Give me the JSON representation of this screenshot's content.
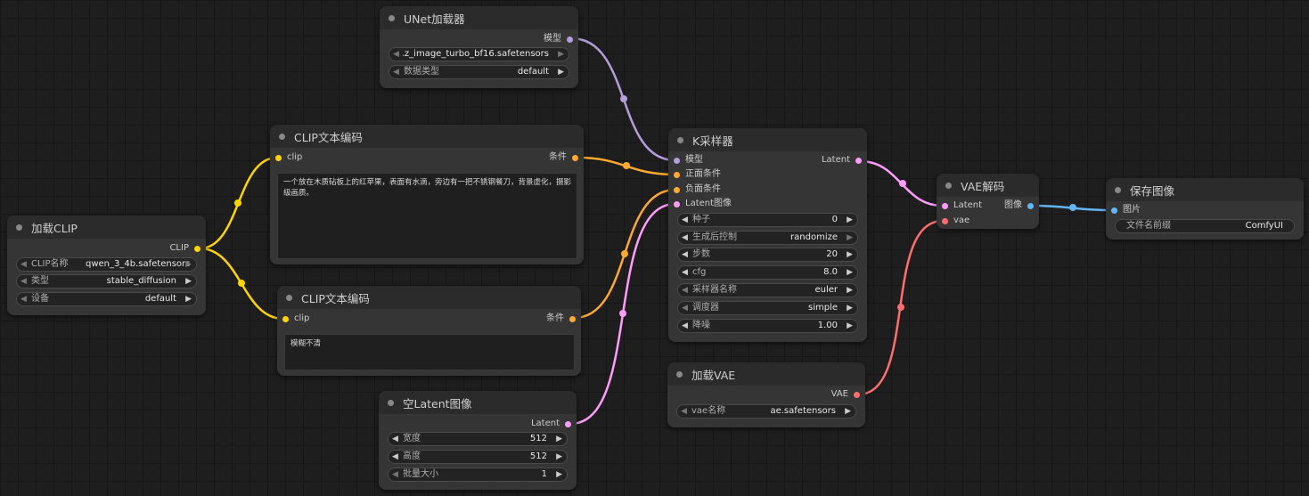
{
  "colors": {
    "clip": "#ffd500",
    "conditioning": "#ffa931",
    "model": "#b39ddb",
    "latent": "#ff9cf9",
    "vae": "#ff6e6e",
    "image": "#64b5f6"
  },
  "nodes": {
    "load_clip": {
      "title": "加载CLIP",
      "output": "CLIP",
      "widgets": [
        {
          "label": "CLIP名称",
          "value": "qwen_3_4b.safetensors"
        },
        {
          "label": "类型",
          "value": "stable_diffusion"
        },
        {
          "label": "设备",
          "value": "default"
        }
      ]
    },
    "clip_text_pos": {
      "title": "CLIP文本编码",
      "input": "clip",
      "output": "条件",
      "text": "一个放在木质砧板上的红苹果，表面有水滴，旁边有一把不锈钢餐刀，背景虚化，摄影级画质。"
    },
    "clip_text_neg": {
      "title": "CLIP文本编码",
      "input": "clip",
      "output": "条件",
      "text": "模糊不清"
    },
    "unet": {
      "title": "UNet加载器",
      "output": "模型",
      "widgets": [
        {
          "label": "",
          "value": "z_image_turbo_bf16.safetensors"
        },
        {
          "label": "数据类型",
          "value": "default"
        }
      ]
    },
    "empty_latent": {
      "title": "空Latent图像",
      "output": "Latent",
      "widgets": [
        {
          "label": "宽度",
          "value": "512"
        },
        {
          "label": "高度",
          "value": "512"
        },
        {
          "label": "批量大小",
          "value": "1"
        }
      ]
    },
    "ksampler": {
      "title": "K采样器",
      "inputs": [
        "模型",
        "正面条件",
        "负面条件",
        "Latent图像"
      ],
      "output": "Latent",
      "widgets": [
        {
          "label": "种子",
          "value": "0"
        },
        {
          "label": "生成后控制",
          "value": "randomize"
        },
        {
          "label": "步数",
          "value": "20"
        },
        {
          "label": "cfg",
          "value": "8.0"
        },
        {
          "label": "采样器名称",
          "value": "euler"
        },
        {
          "label": "调度器",
          "value": "simple"
        },
        {
          "label": "降噪",
          "value": "1.00"
        }
      ]
    },
    "load_vae": {
      "title": "加载VAE",
      "output": "VAE",
      "widgets": [
        {
          "label": "vae名称",
          "value": "ae.safetensors"
        }
      ]
    },
    "vae_decode": {
      "title": "VAE解码",
      "inputs": [
        "Latent",
        "vae"
      ],
      "output": "图像"
    },
    "save_image": {
      "title": "保存图像",
      "input": "图片",
      "widgets": [
        {
          "label": "文件名前缀",
          "value": "ComfyUI"
        }
      ]
    }
  }
}
